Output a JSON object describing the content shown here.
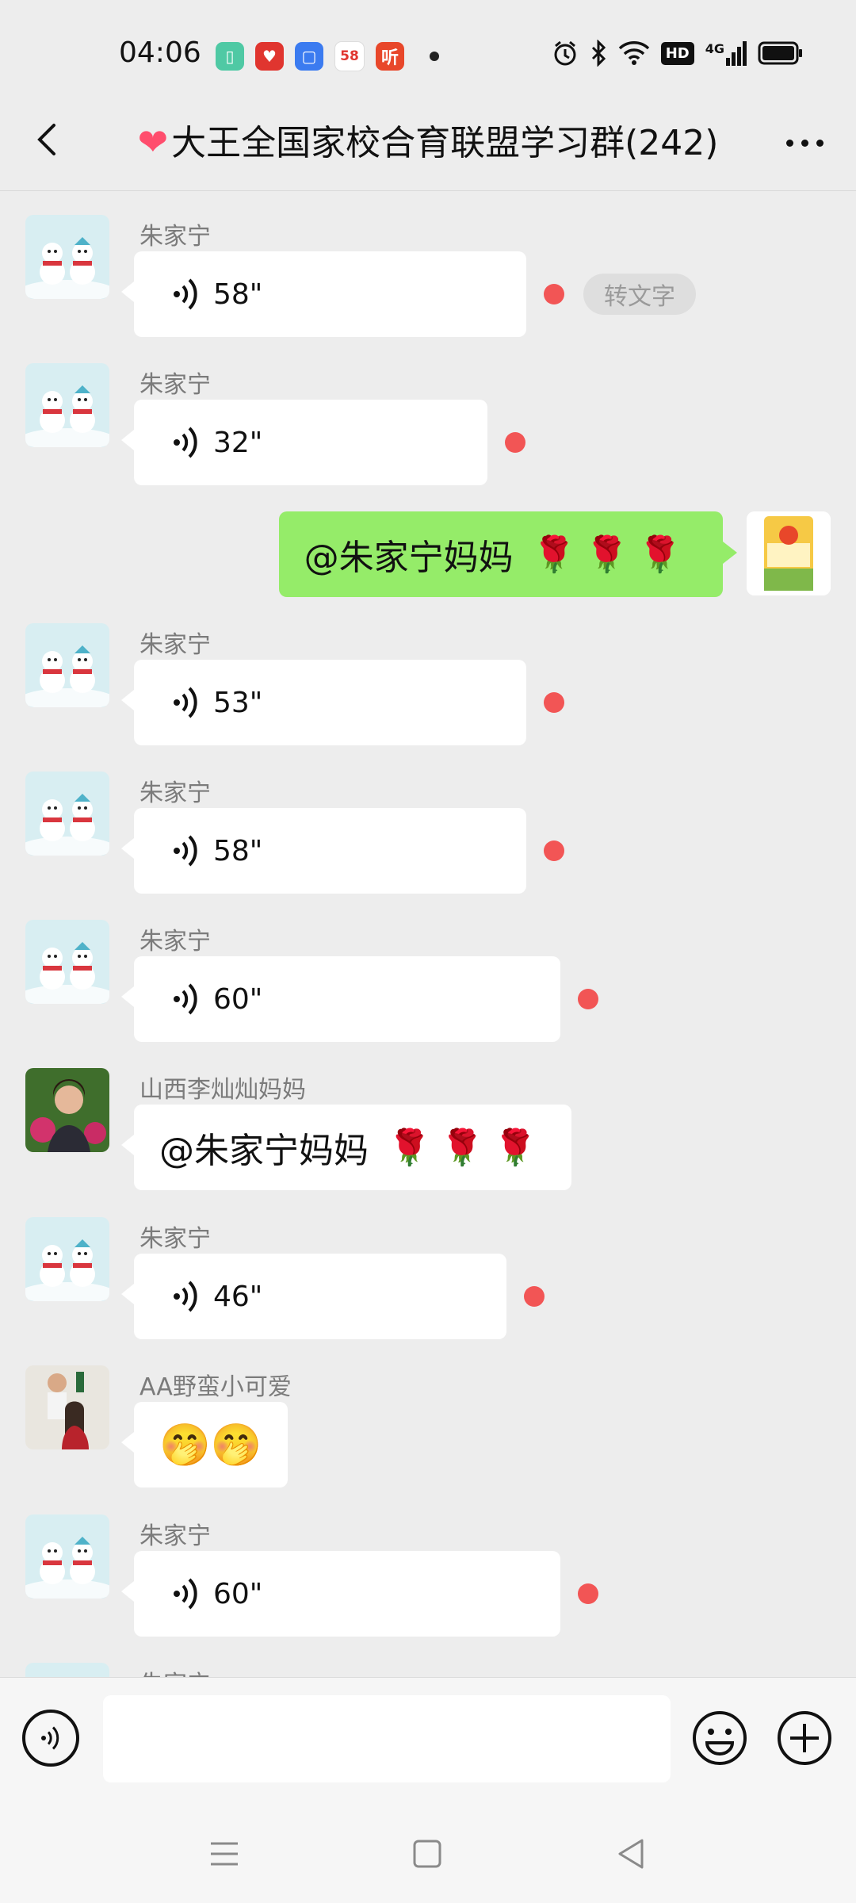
{
  "status_bar": {
    "time": "04:06",
    "app_icons": [
      {
        "name": "green-app-icon",
        "color": "#4fc9a4",
        "glyph": "▯"
      },
      {
        "name": "red-heart-app-icon",
        "color": "#e0352f",
        "glyph": "♥"
      },
      {
        "name": "blue-app-icon",
        "color": "#3b7bf0",
        "glyph": "▢"
      },
      {
        "name": "58-app-icon",
        "color": "#ffffff",
        "glyph": "58"
      },
      {
        "name": "listen-app-icon",
        "color": "#e8472a",
        "glyph": "听"
      }
    ],
    "hd_label": "HD",
    "network_label": "4G"
  },
  "header": {
    "title": "大王全国家校合育联盟学习群(242)",
    "title_prefix_icon": "heart-icon"
  },
  "messages": [
    {
      "type": "voice",
      "sender": "朱家宁",
      "duration": "58\"",
      "unread": true,
      "to_text": "转文字"
    },
    {
      "type": "voice",
      "sender": "朱家宁",
      "duration": "32\"",
      "unread": true
    },
    {
      "type": "mine",
      "text": "@朱家宁妈妈"
    },
    {
      "type": "voice",
      "sender": "朱家宁",
      "duration": "53\"",
      "unread": true
    },
    {
      "type": "voice",
      "sender": "朱家宁",
      "duration": "58\"",
      "unread": true
    },
    {
      "type": "voice",
      "sender": "朱家宁",
      "duration": "60\"",
      "unread": true
    },
    {
      "type": "text",
      "sender": "山西李灿灿妈妈",
      "text": "@朱家宁妈妈"
    },
    {
      "type": "voice",
      "sender": "朱家宁",
      "duration": "46\"",
      "unread": true
    },
    {
      "type": "emoji",
      "sender": "AA野蛮小可爱",
      "text": "🤭🤭"
    },
    {
      "type": "voice",
      "sender": "朱家宁",
      "duration": "60\"",
      "unread": true
    },
    {
      "type": "partial",
      "sender": "朱家宁"
    }
  ],
  "input": {
    "value": "",
    "placeholder": ""
  },
  "colors": {
    "background": "#ededed",
    "my_bubble": "#95ec69",
    "unread_dot": "#f25555"
  }
}
